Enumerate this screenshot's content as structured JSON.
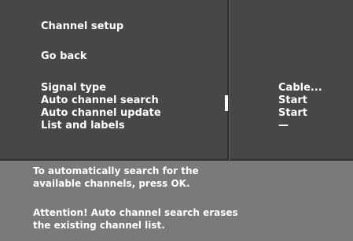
{
  "menu": {
    "title": "Channel setup",
    "go_back": "Go back",
    "items": [
      {
        "label": "Signal type",
        "value": "Cable..."
      },
      {
        "label": "Auto channel search",
        "value": "Start"
      },
      {
        "label": "Auto channel update",
        "value": "Start"
      },
      {
        "label": "List and labels",
        "value": "—"
      }
    ]
  },
  "help": {
    "line1": "To automatically search for the",
    "line2": "available channels, press OK.",
    "line3": "Attention! Auto channel search erases",
    "line4": "the existing channel list."
  },
  "colors": {
    "menu_background": "#474747",
    "help_background": "#7a7a7a",
    "text": "#ffffff"
  }
}
